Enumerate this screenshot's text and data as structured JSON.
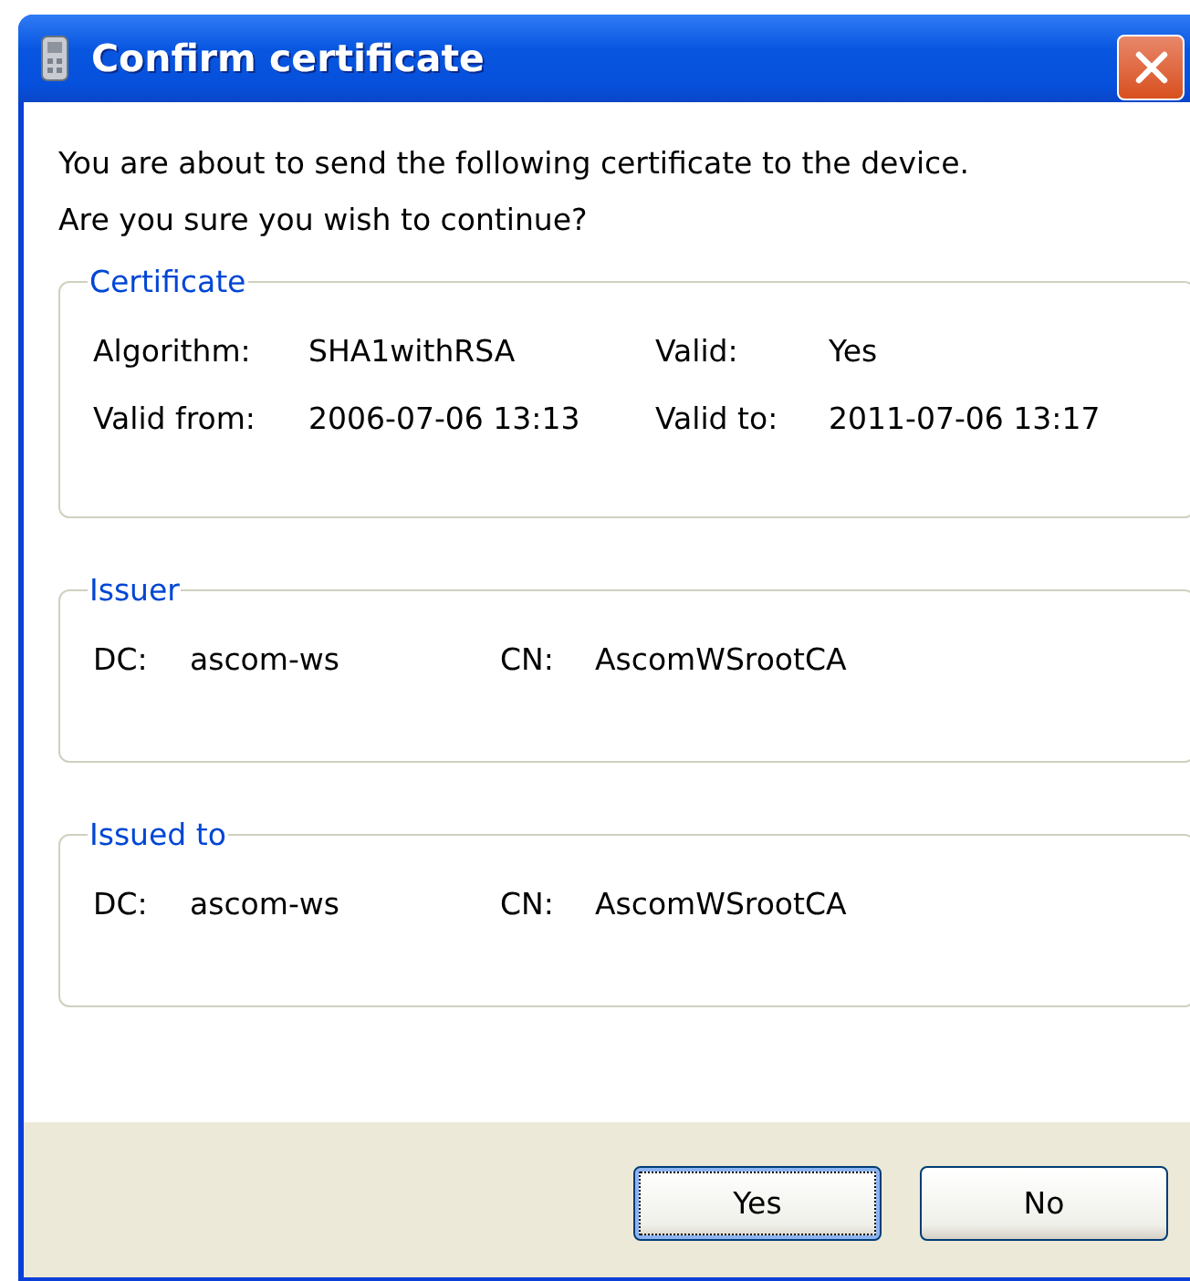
{
  "window": {
    "title": "Confirm certificate"
  },
  "message": [
    "You are about to send the following certificate to the device.",
    "Are you sure you wish to continue?"
  ],
  "groups": [
    {
      "title": "Certificate",
      "kind": "grid4",
      "rows": [
        [
          {
            "label": "Algorithm:",
            "value": "SHA1withRSA"
          },
          {
            "label": "Valid:",
            "value": "Yes"
          }
        ],
        [
          {
            "label": "Valid from:",
            "value": "2006-07-06 13:13"
          },
          {
            "label": "Valid to:",
            "value": "2011-07-06 13:17"
          }
        ]
      ]
    },
    {
      "title": "Issuer",
      "kind": "pairs",
      "rows": [
        [
          {
            "label": "DC:",
            "value": "ascom-ws"
          },
          {
            "label": "CN:",
            "value": "AscomWSrootCA"
          }
        ]
      ]
    },
    {
      "title": "Issued to",
      "kind": "pairs",
      "rows": [
        [
          {
            "label": "DC:",
            "value": "ascom-ws"
          },
          {
            "label": "CN:",
            "value": "AscomWSrootCA"
          }
        ]
      ]
    }
  ],
  "buttons": [
    {
      "label": "Yes",
      "focused": true
    },
    {
      "label": "No",
      "focused": false
    }
  ]
}
